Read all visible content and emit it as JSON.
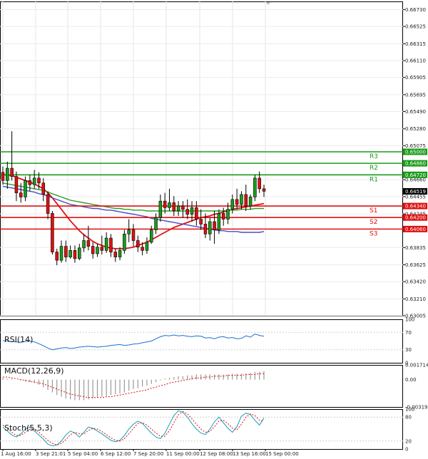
{
  "chart_data": [
    {
      "type": "candlestick",
      "ylim": [
        0.63005,
        0.6683
      ],
      "yticks": [
        0.6673,
        0.66525,
        0.66315,
        0.6611,
        0.65905,
        0.65695,
        0.6549,
        0.6528,
        0.65075,
        0.6466,
        0.64455,
        0.64245,
        0.63835,
        0.63625,
        0.6342,
        0.6321,
        0.63005
      ],
      "xtick_labels": [
        "1 Aug 16:00",
        "3 Sep 21:01",
        "5 Sep 04:00",
        "6 Sep 12:00",
        "7 Sep 20:00",
        "11 Sep 00:00",
        "12 Sep 08:00",
        "13 Sep 16:00",
        "15 Sep 00:00"
      ],
      "current_price": {
        "value": 0.64519,
        "label": "0.64519",
        "color": "#000000"
      },
      "levels": [
        {
          "name": "R3",
          "value": 0.65,
          "label": "0.65000",
          "color": "#1a9c1a"
        },
        {
          "name": "R2",
          "value": 0.6486,
          "label": "0.64860",
          "color": "#1a9c1a"
        },
        {
          "name": "R1",
          "value": 0.6472,
          "label": "0.64720",
          "color": "#1a9c1a"
        },
        {
          "name": "S1",
          "value": 0.6434,
          "label": "0.64340",
          "color": "#e01010"
        },
        {
          "name": "S2",
          "value": 0.642,
          "label": "0.64200",
          "color": "#e01010"
        },
        {
          "name": "S3",
          "value": 0.6406,
          "label": "0.64060",
          "color": "#e01010"
        }
      ],
      "candles": [
        [
          0.6475,
          0.6482,
          0.646,
          0.6465
        ],
        [
          0.6465,
          0.6488,
          0.6455,
          0.648
        ],
        [
          0.648,
          0.6525,
          0.6465,
          0.647
        ],
        [
          0.647,
          0.6476,
          0.644,
          0.645
        ],
        [
          0.645,
          0.6462,
          0.6438,
          0.6445
        ],
        [
          0.6445,
          0.647,
          0.644,
          0.6465
        ],
        [
          0.6465,
          0.6472,
          0.6452,
          0.646
        ],
        [
          0.646,
          0.6478,
          0.6455,
          0.6468
        ],
        [
          0.6468,
          0.6475,
          0.6455,
          0.6462
        ],
        [
          0.6462,
          0.6468,
          0.644,
          0.6448
        ],
        [
          0.6448,
          0.6452,
          0.6418,
          0.6425
        ],
        [
          0.6425,
          0.6428,
          0.6375,
          0.6378
        ],
        [
          0.6378,
          0.6382,
          0.6362,
          0.6368
        ],
        [
          0.6368,
          0.6392,
          0.6365,
          0.6385
        ],
        [
          0.6385,
          0.6392,
          0.6366,
          0.6372
        ],
        [
          0.6372,
          0.6386,
          0.637,
          0.638
        ],
        [
          0.638,
          0.6386,
          0.6365,
          0.637
        ],
        [
          0.637,
          0.6388,
          0.6368,
          0.6383
        ],
        [
          0.6383,
          0.64,
          0.6378,
          0.6392
        ],
        [
          0.6392,
          0.641,
          0.638,
          0.6385
        ],
        [
          0.6385,
          0.639,
          0.637,
          0.6376
        ],
        [
          0.6376,
          0.6388,
          0.6372,
          0.6384
        ],
        [
          0.6384,
          0.6398,
          0.6375,
          0.638
        ],
        [
          0.638,
          0.6402,
          0.6377,
          0.6395
        ],
        [
          0.6395,
          0.64,
          0.6372,
          0.6378
        ],
        [
          0.6378,
          0.6382,
          0.6366,
          0.6372
        ],
        [
          0.6372,
          0.6384,
          0.6368,
          0.638
        ],
        [
          0.638,
          0.6405,
          0.6376,
          0.64
        ],
        [
          0.64,
          0.6418,
          0.639,
          0.6405
        ],
        [
          0.6405,
          0.6412,
          0.6385,
          0.6392
        ],
        [
          0.6392,
          0.6398,
          0.6378,
          0.6384
        ],
        [
          0.6384,
          0.639,
          0.6374,
          0.638
        ],
        [
          0.638,
          0.6396,
          0.6376,
          0.639
        ],
        [
          0.639,
          0.641,
          0.6388,
          0.6405
        ],
        [
          0.6405,
          0.6425,
          0.64,
          0.642
        ],
        [
          0.642,
          0.6448,
          0.6415,
          0.644
        ],
        [
          0.644,
          0.645,
          0.6425,
          0.6432
        ],
        [
          0.6432,
          0.6455,
          0.6428,
          0.6438
        ],
        [
          0.6438,
          0.6446,
          0.6422,
          0.6428
        ],
        [
          0.6428,
          0.644,
          0.6422,
          0.6434
        ],
        [
          0.6434,
          0.644,
          0.642,
          0.643
        ],
        [
          0.643,
          0.6442,
          0.6418,
          0.6424
        ],
        [
          0.6424,
          0.644,
          0.6415,
          0.6432
        ],
        [
          0.6432,
          0.644,
          0.641,
          0.6418
        ],
        [
          0.6418,
          0.643,
          0.6405,
          0.6412
        ],
        [
          0.6412,
          0.6425,
          0.6395,
          0.64
        ],
        [
          0.64,
          0.642,
          0.6392,
          0.6415
        ],
        [
          0.6415,
          0.6428,
          0.6388,
          0.6405
        ],
        [
          0.6405,
          0.643,
          0.64,
          0.6425
        ],
        [
          0.6425,
          0.6432,
          0.641,
          0.6418
        ],
        [
          0.6418,
          0.6438,
          0.6412,
          0.643
        ],
        [
          0.643,
          0.6448,
          0.6425,
          0.6442
        ],
        [
          0.6442,
          0.6455,
          0.643,
          0.6436
        ],
        [
          0.6436,
          0.6452,
          0.643,
          0.6448
        ],
        [
          0.6448,
          0.646,
          0.6428,
          0.6434
        ],
        [
          0.6434,
          0.6448,
          0.643,
          0.6445
        ],
        [
          0.6445,
          0.6472,
          0.644,
          0.6468
        ],
        [
          0.6468,
          0.6476,
          0.645,
          0.6455
        ],
        [
          0.6455,
          0.646,
          0.6445,
          0.6452
        ]
      ],
      "moving_averages": [
        {
          "color": "#e01010",
          "values": [
            0.6472,
            0.6472,
            0.6471,
            0.6469,
            0.6467,
            0.6465,
            0.6463,
            0.6461,
            0.6458,
            0.6455,
            0.645,
            0.6444,
            0.6437,
            0.643,
            0.6423,
            0.6416,
            0.641,
            0.6404,
            0.6399,
            0.6395,
            0.6391,
            0.6388,
            0.6386,
            0.6384,
            0.6383,
            0.6382,
            0.6382,
            0.6382,
            0.6383,
            0.6384,
            0.6386,
            0.6388,
            0.639,
            0.6393,
            0.6396,
            0.6399,
            0.6402,
            0.6405,
            0.6408,
            0.641,
            0.6412,
            0.6414,
            0.6416,
            0.6418,
            0.642,
            0.6421,
            0.6422,
            0.6424,
            0.6425,
            0.6427,
            0.6428,
            0.643,
            0.6431,
            0.6432,
            0.6433,
            0.6434,
            0.6435,
            0.6436,
            0.6437
          ]
        },
        {
          "color": "#2ca02c",
          "values": [
            0.6462,
            0.6461,
            0.646,
            0.6459,
            0.6458,
            0.6457,
            0.6456,
            0.6455,
            0.6454,
            0.6453,
            0.6451,
            0.6449,
            0.6447,
            0.6445,
            0.6443,
            0.6441,
            0.644,
            0.6439,
            0.6438,
            0.6437,
            0.6436,
            0.6435,
            0.6434,
            0.6433,
            0.6432,
            0.6431,
            0.6431,
            0.643,
            0.643,
            0.6429,
            0.6429,
            0.6429,
            0.6428,
            0.6428,
            0.6428,
            0.6428,
            0.6428,
            0.6428,
            0.6428,
            0.6428,
            0.6428,
            0.6428,
            0.6428,
            0.6428,
            0.6428,
            0.6428,
            0.6428,
            0.6428,
            0.6428,
            0.6428,
            0.6429,
            0.6429,
            0.6429,
            0.643,
            0.643,
            0.643,
            0.6431,
            0.6431,
            0.6431
          ]
        },
        {
          "color": "#4b4bc8",
          "values": [
            0.6458,
            0.6457,
            0.6456,
            0.6455,
            0.6454,
            0.6453,
            0.6452,
            0.6451,
            0.6449,
            0.6448,
            0.6446,
            0.6444,
            0.6442,
            0.644,
            0.6438,
            0.6436,
            0.6435,
            0.6434,
            0.6433,
            0.6432,
            0.6431,
            0.6431,
            0.643,
            0.6429,
            0.6429,
            0.6428,
            0.6427,
            0.6426,
            0.6425,
            0.6424,
            0.6423,
            0.6422,
            0.6421,
            0.6419,
            0.6418,
            0.6417,
            0.6416,
            0.6415,
            0.6414,
            0.6413,
            0.6412,
            0.6411,
            0.641,
            0.6409,
            0.6408,
            0.6407,
            0.6406,
            0.6405,
            0.6404,
            0.6404,
            0.6403,
            0.6403,
            0.6403,
            0.6402,
            0.6402,
            0.6402,
            0.6402,
            0.6402,
            0.6403
          ]
        }
      ]
    },
    {
      "type": "line",
      "label": "RSI(14)",
      "ylim": [
        0,
        100
      ],
      "yticks": [
        100,
        70,
        30,
        0
      ],
      "series": [
        {
          "color": "#1c6fd1",
          "values": [
            51,
            50,
            49,
            48,
            47,
            49,
            50,
            48,
            44,
            39,
            34,
            30,
            32,
            34,
            35,
            33,
            34,
            36,
            37,
            38,
            37,
            36,
            37,
            38,
            40,
            41,
            42,
            40,
            41,
            43,
            44,
            46,
            48,
            50,
            55,
            60,
            63,
            62,
            64,
            62,
            63,
            61,
            60,
            62,
            61,
            57,
            58,
            55,
            59,
            60,
            57,
            58,
            55,
            56,
            62,
            59,
            66,
            63,
            61
          ]
        }
      ]
    },
    {
      "type": "bar",
      "label": "MACD(12,26,9)",
      "ylim": [
        -0.003195,
        0.001714
      ],
      "yticks": [
        0.001714,
        0.0,
        -0.003195
      ],
      "yticklabels": [
        "0.001714",
        "0.00",
        "-0.003195"
      ],
      "values": [
        0.0002,
        0.0001,
        0.0001,
        0.0,
        -0.0001,
        -0.0002,
        -0.0003,
        -0.0004,
        -0.0006,
        -0.0009,
        -0.0012,
        -0.0015,
        -0.0018,
        -0.002,
        -0.0022,
        -0.0023,
        -0.0024,
        -0.0024,
        -0.0024,
        -0.0023,
        -0.0022,
        -0.0021,
        -0.002,
        -0.0019,
        -0.0018,
        -0.0017,
        -0.0016,
        -0.0015,
        -0.0013,
        -0.0011,
        -0.001,
        -0.0008,
        -0.0007,
        -0.0005,
        -0.0003,
        -0.0001,
        0.0001,
        0.0002,
        0.0003,
        0.0004,
        0.0004,
        0.0005,
        0.0005,
        0.0006,
        0.0006,
        0.0006,
        0.0006,
        0.0006,
        0.0006,
        0.0006,
        0.0006,
        0.0007,
        0.0007,
        0.0007,
        0.0007,
        0.0008,
        0.0009,
        0.0009,
        0.001
      ],
      "signal": {
        "color": "#e01010",
        "values": [
          0.0003,
          0.0003,
          0.0002,
          0.0001,
          0.0,
          -0.0001,
          -0.0002,
          -0.0003,
          -0.0004,
          -0.0005,
          -0.0007,
          -0.0009,
          -0.0011,
          -0.0013,
          -0.0015,
          -0.0017,
          -0.0018,
          -0.0019,
          -0.002,
          -0.0021,
          -0.0021,
          -0.0021,
          -0.0021,
          -0.002,
          -0.002,
          -0.0019,
          -0.0018,
          -0.0017,
          -0.0016,
          -0.0015,
          -0.0014,
          -0.0013,
          -0.0012,
          -0.001,
          -0.0009,
          -0.0007,
          -0.0006,
          -0.0004,
          -0.0003,
          -0.0002,
          -0.0001,
          0.0,
          0.0001,
          0.0002,
          0.0002,
          0.0003,
          0.0003,
          0.0004,
          0.0004,
          0.0004,
          0.0005,
          0.0005,
          0.0005,
          0.0005,
          0.0006,
          0.0006,
          0.0006,
          0.0007,
          0.0007
        ]
      }
    },
    {
      "type": "line",
      "label": "Stoch(5,5,3)",
      "ylim": [
        0,
        100
      ],
      "yticks": [
        100,
        80,
        20,
        0
      ],
      "series": [
        {
          "color": "#1aa0b4",
          "values": [
            55,
            45,
            35,
            30,
            38,
            50,
            55,
            45,
            35,
            25,
            12,
            8,
            10,
            20,
            35,
            45,
            40,
            30,
            42,
            55,
            52,
            45,
            38,
            30,
            22,
            18,
            22,
            34,
            50,
            62,
            70,
            64,
            52,
            40,
            30,
            26,
            40,
            62,
            84,
            96,
            92,
            80,
            64,
            50,
            40,
            36,
            50,
            68,
            80,
            66,
            52,
            42,
            56,
            82,
            90,
            86,
            72,
            60,
            78
          ]
        },
        {
          "color": "#e01010",
          "values": [
            60,
            52,
            42,
            34,
            34,
            42,
            50,
            50,
            42,
            32,
            22,
            14,
            10,
            14,
            24,
            36,
            42,
            38,
            38,
            46,
            52,
            50,
            44,
            36,
            28,
            22,
            20,
            26,
            38,
            52,
            64,
            66,
            60,
            50,
            40,
            32,
            32,
            46,
            66,
            86,
            94,
            88,
            76,
            62,
            50,
            42,
            44,
            56,
            70,
            72,
            64,
            52,
            48,
            62,
            80,
            88,
            84,
            72,
            70
          ]
        }
      ]
    }
  ]
}
